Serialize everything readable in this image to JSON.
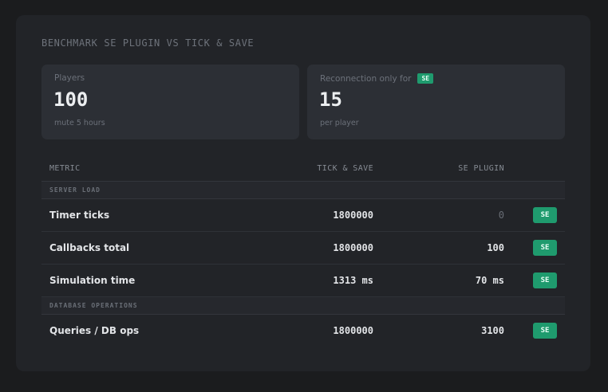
{
  "header": {
    "label": "BENCHMARK",
    "title": "SE PLUGIN VS TICK & SAVE"
  },
  "stats": [
    {
      "label": "Players",
      "value": "100",
      "sub": "mute 5 hours"
    },
    {
      "label": "Reconnection only for",
      "badge": "SE",
      "value": "15",
      "sub": "per player"
    }
  ],
  "table": {
    "columns": {
      "metric": "METRIC",
      "tick": "TICK & SAVE",
      "se": "SE PLUGIN"
    },
    "sections": [
      {
        "title": "SERVER LOAD",
        "rows": [
          {
            "metric": "Timer ticks",
            "tick": "1800000",
            "se": "0",
            "winner": "SE"
          },
          {
            "metric": "Callbacks total",
            "tick": "1800000",
            "se": "100",
            "winner": "SE"
          },
          {
            "metric": "Simulation time",
            "tick": "1313 ms",
            "se": "70 ms",
            "winner": "SE"
          }
        ]
      },
      {
        "title": "DATABASE OPERATIONS",
        "rows": [
          {
            "metric": "Queries / DB ops",
            "tick": "1800000",
            "se": "3100",
            "winner": "SE"
          }
        ]
      }
    ]
  },
  "colors": {
    "accent": "#1f9b6e",
    "card": "#222428",
    "panel": "#2c2f35"
  }
}
